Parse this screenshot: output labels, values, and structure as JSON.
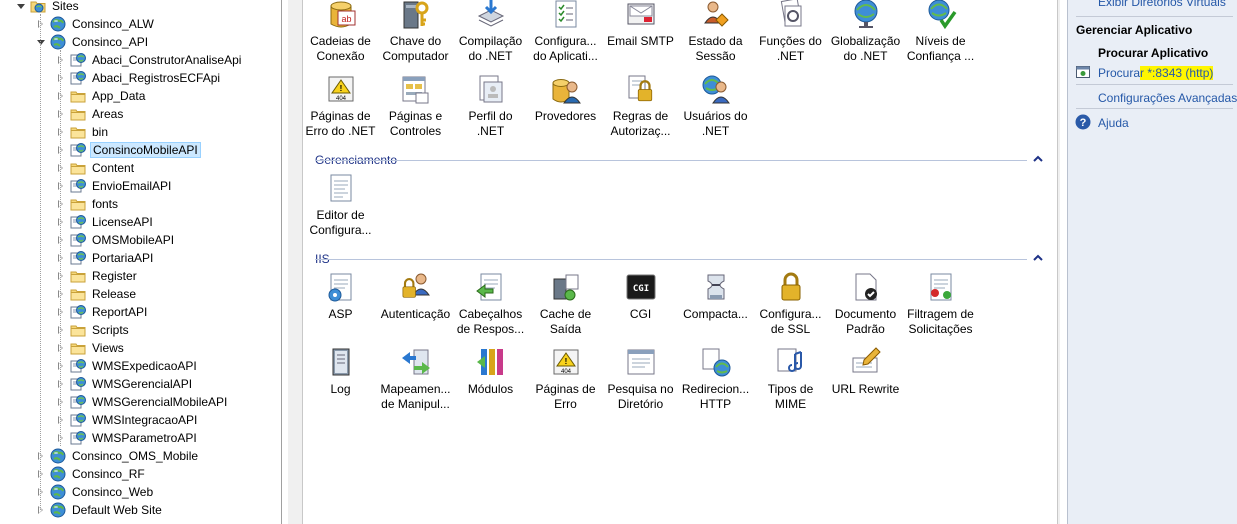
{
  "tree": {
    "items": [
      {
        "label": "Sites",
        "depth": 0,
        "state": "expanded",
        "icon": "sites-folder-icon"
      },
      {
        "label": "Consinco_ALW",
        "depth": 1,
        "state": "collapsed",
        "icon": "globe-icon"
      },
      {
        "label": "Consinco_API",
        "depth": 1,
        "state": "expanded",
        "icon": "globe-icon"
      },
      {
        "label": "Abaci_ConstrutorAnaliseApi",
        "depth": 2,
        "state": "collapsed",
        "icon": "web-app-icon"
      },
      {
        "label": "Abaci_RegistrosECFApi",
        "depth": 2,
        "state": "collapsed",
        "icon": "web-app-icon"
      },
      {
        "label": "App_Data",
        "depth": 2,
        "state": "collapsed",
        "icon": "folder-icon"
      },
      {
        "label": "Areas",
        "depth": 2,
        "state": "collapsed",
        "icon": "folder-icon"
      },
      {
        "label": "bin",
        "depth": 2,
        "state": "collapsed",
        "icon": "folder-icon"
      },
      {
        "label": "ConsincoMobileAPI",
        "depth": 2,
        "state": "collapsed",
        "icon": "web-app-icon",
        "selected": true
      },
      {
        "label": "Content",
        "depth": 2,
        "state": "collapsed",
        "icon": "folder-icon"
      },
      {
        "label": "EnvioEmailAPI",
        "depth": 2,
        "state": "collapsed",
        "icon": "web-app-icon"
      },
      {
        "label": "fonts",
        "depth": 2,
        "state": "collapsed",
        "icon": "folder-icon"
      },
      {
        "label": "LicenseAPI",
        "depth": 2,
        "state": "collapsed",
        "icon": "web-app-icon"
      },
      {
        "label": "OMSMobileAPI",
        "depth": 2,
        "state": "collapsed",
        "icon": "web-app-icon"
      },
      {
        "label": "PortariaAPI",
        "depth": 2,
        "state": "collapsed",
        "icon": "web-app-icon"
      },
      {
        "label": "Register",
        "depth": 2,
        "state": "collapsed",
        "icon": "folder-icon"
      },
      {
        "label": "Release",
        "depth": 2,
        "state": "collapsed",
        "icon": "folder-icon"
      },
      {
        "label": "ReportAPI",
        "depth": 2,
        "state": "collapsed",
        "icon": "web-app-icon"
      },
      {
        "label": "Scripts",
        "depth": 2,
        "state": "collapsed",
        "icon": "folder-icon"
      },
      {
        "label": "Views",
        "depth": 2,
        "state": "collapsed",
        "icon": "folder-icon"
      },
      {
        "label": "WMSExpedicaoAPI",
        "depth": 2,
        "state": "collapsed",
        "icon": "web-app-icon"
      },
      {
        "label": "WMSGerencialAPI",
        "depth": 2,
        "state": "collapsed",
        "icon": "web-app-icon"
      },
      {
        "label": "WMSGerencialMobileAPI",
        "depth": 2,
        "state": "collapsed",
        "icon": "web-app-icon"
      },
      {
        "label": "WMSIntegracaoAPI",
        "depth": 2,
        "state": "collapsed",
        "icon": "web-app-icon"
      },
      {
        "label": "WMSParametroAPI",
        "depth": 2,
        "state": "collapsed",
        "icon": "web-app-icon"
      },
      {
        "label": "Consinco_OMS_Mobile",
        "depth": 1,
        "state": "collapsed",
        "icon": "globe-icon"
      },
      {
        "label": "Consinco_RF",
        "depth": 1,
        "state": "collapsed",
        "icon": "globe-icon"
      },
      {
        "label": "Consinco_Web",
        "depth": 1,
        "state": "collapsed",
        "icon": "globe-icon"
      },
      {
        "label": "Default Web Site",
        "depth": 1,
        "state": "collapsed",
        "icon": "globe-icon"
      }
    ]
  },
  "features": {
    "top_row1": [
      {
        "line1": "Cadeias de",
        "line2": "Conexão",
        "icon": "connection-strings-icon"
      },
      {
        "line1": "Chave do",
        "line2": "Computador",
        "icon": "machine-key-icon"
      },
      {
        "line1": "Compilação",
        "line2": "do .NET",
        "icon": "compilation-icon"
      },
      {
        "line1": "Configura...",
        "line2": "do Aplicati...",
        "icon": "app-settings-icon"
      },
      {
        "line1": "Email SMTP",
        "line2": "",
        "icon": "smtp-email-icon"
      },
      {
        "line1": "Estado da",
        "line2": "Sessão",
        "icon": "session-state-icon"
      },
      {
        "line1": "Funções do",
        "line2": ".NET",
        "icon": "net-roles-icon"
      },
      {
        "line1": "Globalização",
        "line2": "do .NET",
        "icon": "globalization-icon"
      },
      {
        "line1": "Níveis de",
        "line2": "Confiança ...",
        "icon": "trust-levels-icon"
      }
    ],
    "top_row2": [
      {
        "line1": "Páginas de",
        "line2": "Erro do .NET",
        "icon": "net-error-pages-icon"
      },
      {
        "line1": "Páginas e",
        "line2": "Controles",
        "icon": "pages-controls-icon"
      },
      {
        "line1": "Perfil do",
        "line2": ".NET",
        "icon": "net-profile-icon"
      },
      {
        "line1": "Provedores",
        "line2": "",
        "icon": "providers-icon"
      },
      {
        "line1": "Regras de",
        "line2": "Autorizaç...",
        "icon": "authorization-rules-icon"
      },
      {
        "line1": "Usuários do",
        "line2": ".NET",
        "icon": "net-users-icon"
      }
    ],
    "management_title": "Gerenciamento",
    "management": [
      {
        "line1": "Editor de",
        "line2": "Configura...",
        "icon": "config-editor-icon"
      }
    ],
    "iis_title": "IIS",
    "iis_row1": [
      {
        "line1": "ASP",
        "line2": "",
        "icon": "asp-icon"
      },
      {
        "line1": "Autenticação",
        "line2": "",
        "icon": "authentication-icon"
      },
      {
        "line1": "Cabeçalhos",
        "line2": "de Respos...",
        "icon": "response-headers-icon"
      },
      {
        "line1": "Cache de",
        "line2": "Saída",
        "icon": "output-cache-icon"
      },
      {
        "line1": "CGI",
        "line2": "",
        "icon": "cgi-icon"
      },
      {
        "line1": "Compacta...",
        "line2": "",
        "icon": "compression-icon"
      },
      {
        "line1": "Configura...",
        "line2": "de SSL",
        "icon": "ssl-settings-icon"
      },
      {
        "line1": "Documento",
        "line2": "Padrão",
        "icon": "default-document-icon"
      },
      {
        "line1": "Filtragem de",
        "line2": "Solicitações",
        "icon": "request-filtering-icon"
      }
    ],
    "iis_row2": [
      {
        "line1": "Log",
        "line2": "",
        "icon": "logging-icon"
      },
      {
        "line1": "Mapeamen...",
        "line2": "de Manipul...",
        "icon": "handler-mappings-icon"
      },
      {
        "line1": "Módulos",
        "line2": "",
        "icon": "modules-icon"
      },
      {
        "line1": "Páginas de",
        "line2": "Erro",
        "icon": "error-pages-icon"
      },
      {
        "line1": "Pesquisa no",
        "line2": "Diretório",
        "icon": "directory-browsing-icon"
      },
      {
        "line1": "Redirecion...",
        "line2": "HTTP",
        "icon": "http-redirect-icon"
      },
      {
        "line1": "Tipos de",
        "line2": "MIME",
        "icon": "mime-types-icon"
      },
      {
        "line1": "URL Rewrite",
        "line2": "",
        "icon": "url-rewrite-icon"
      }
    ]
  },
  "actions": {
    "top_link": "Exibir Diretórios Virtuais",
    "manage_app_header": "Gerenciar Aplicativo",
    "browse_app_header": "Procurar Aplicativo",
    "browse_prefix": "Procura",
    "browse_highlight": "r *:8343 (http)",
    "advanced_settings": "Configurações Avançadas",
    "help": "Ajuda"
  },
  "colors": {
    "link": "#2558a8",
    "section_title": "#1e3287",
    "highlight": "#fff600",
    "actions_bg": "#e9eef6",
    "selected_bg": "#cce8ff"
  }
}
